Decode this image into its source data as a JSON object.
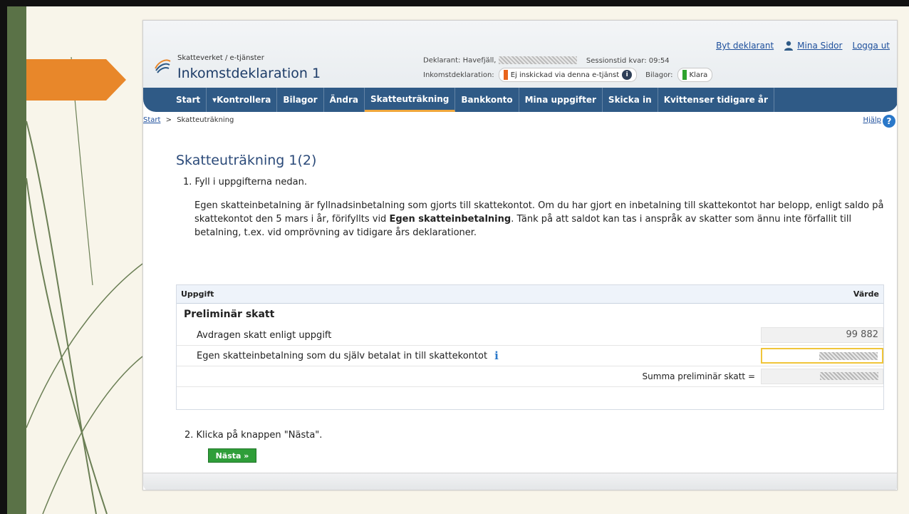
{
  "header": {
    "org": "Skatteverket / e-tjänster",
    "title": "Inkomstdeklaration 1",
    "deklarant_label": "Deklarant: Havefjäll,",
    "session_label": "Sessionstid kvar: 09:54",
    "status_label": "Inkomstdeklaration:",
    "status_value": "Ej inskickad via denna e-tjänst",
    "bilagor_label": "Bilagor:",
    "bilagor_value": "Klara",
    "links": {
      "byt_deklarant": "Byt deklarant",
      "mina_sidor": "Mina Sidor",
      "logga_ut": "Logga ut"
    }
  },
  "nav": {
    "items": [
      {
        "label": "Start"
      },
      {
        "label": "▾Kontrollera"
      },
      {
        "label": "Bilagor"
      },
      {
        "label": "Ändra"
      },
      {
        "label": "Skatteuträkning"
      },
      {
        "label": "Bankkonto"
      },
      {
        "label": "Mina uppgifter"
      },
      {
        "label": "Skicka in"
      },
      {
        "label": "Kvittenser tidigare år"
      }
    ],
    "active": "Skatteuträkning"
  },
  "breadcrumb": {
    "start": "Start",
    "sep": ">",
    "current": "Skatteuträkning",
    "help": "Hjälp"
  },
  "main": {
    "title": "Skatteuträkning 1(2)",
    "step1": "1. Fyll i uppgifterna nedan.",
    "para_part1": "Egen skatteinbetalning är fyllnadsinbetalning som gjorts till skattekontot. Om du har gjort en inbetalning till skattekontot har belopp, enligt saldo på skattekontot den 5 mars i år, förifyllts vid ",
    "para_bold": "Egen skatteinbetalning",
    "para_part2": ". Tänk på att saldot kan tas i anspråk av skatter som ännu inte förfallit till betalning, t.ex. vid omprövning av tidigare års deklarationer.",
    "step2": "2. Klicka på knappen \"Nästa\".",
    "next_button": "Nästa »"
  },
  "table": {
    "col_uppgift": "Uppgift",
    "col_varde": "Värde",
    "section": "Preliminär skatt",
    "rows": [
      {
        "label": "Avdragen skatt enligt uppgift",
        "value": "99 882"
      },
      {
        "label": "Egen skatteinbetalning som du själv betalat in till skattekontot",
        "value": ""
      },
      {
        "label": "Summa preliminär skatt =",
        "value": ""
      }
    ]
  },
  "colors": {
    "nav_blue": "#2f5a86",
    "accent_orange": "#e8641c",
    "slide_green": "#5a7247",
    "button_green": "#2f9e39"
  }
}
